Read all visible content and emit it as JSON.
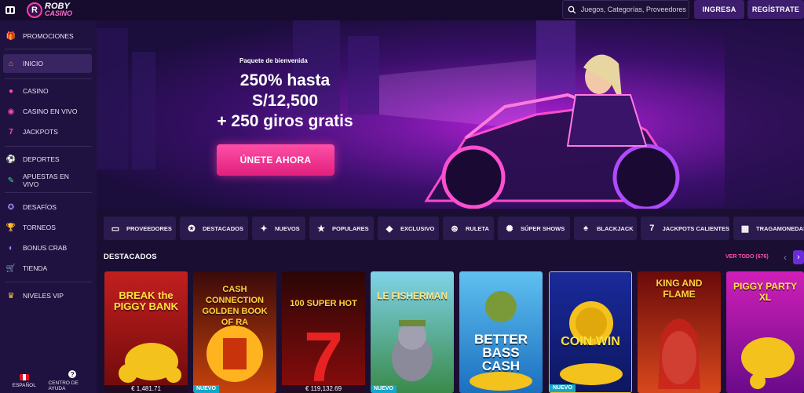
{
  "topbar": {
    "logo_line1": "ROBY",
    "logo_line2": "CASINO",
    "logo_mark": "R",
    "search_placeholder": "Juegos, Categorías, Proveedores",
    "login_label": "INGRESA",
    "register_label": "REGÍSTRATE"
  },
  "sidebar": {
    "items": [
      {
        "label": "PROMOCIONES",
        "icon": "gift-icon",
        "glyph": "🎁"
      },
      {
        "label": "INICIO",
        "icon": "home-icon",
        "glyph": "⌂"
      },
      {
        "label": "CASINO",
        "icon": "chip-icon",
        "glyph": "●"
      },
      {
        "label": "CASINO EN VIVO",
        "icon": "live-icon",
        "glyph": "◉"
      },
      {
        "label": "JACKPOTS",
        "icon": "seven-icon",
        "glyph": "7"
      },
      {
        "label": "DEPORTES",
        "icon": "ball-icon",
        "glyph": "⚽"
      },
      {
        "label": "APUESTAS EN VIVO",
        "icon": "ticket-icon",
        "glyph": "✎"
      },
      {
        "label": "DESAFÍOS",
        "icon": "medal-icon",
        "glyph": "✪"
      },
      {
        "label": "TORNEOS",
        "icon": "trophy-icon",
        "glyph": "🏆"
      },
      {
        "label": "BONUS CRAB",
        "icon": "crab-icon",
        "glyph": "◐"
      },
      {
        "label": "TIENDA",
        "icon": "cart-icon",
        "glyph": "🛒"
      },
      {
        "label": "NIVELES VIP",
        "icon": "crown-icon",
        "glyph": "♛"
      }
    ],
    "language_label": "ESPAÑOL",
    "help_label": "CENTRO DE AYUDA"
  },
  "hero": {
    "subtitle": "Paquete de bienvenida",
    "title_line1": "250% hasta",
    "title_line2": "S/12,500",
    "title_line3": "+ 250 giros gratis",
    "cta_label": "ÚNETE AHORA"
  },
  "chips": [
    {
      "label": "PROVEEDORES",
      "glyph": "▭"
    },
    {
      "label": "DESTACADOS",
      "glyph": "✪"
    },
    {
      "label": "NUEVOS",
      "glyph": "✦"
    },
    {
      "label": "POPULARES",
      "glyph": "★"
    },
    {
      "label": "EXCLUSIVO",
      "glyph": "◆"
    },
    {
      "label": "RULETA",
      "glyph": "⊛"
    },
    {
      "label": "SÚPER SHOWS",
      "glyph": "✺"
    },
    {
      "label": "BLACKJACK",
      "glyph": "♠"
    },
    {
      "label": "JACKPOTS CALIENTES",
      "glyph": "7"
    },
    {
      "label": "TRAGAMONEDAS",
      "glyph": "▦"
    }
  ],
  "section": {
    "title": "DESTACADOS",
    "see_all": "VER TODO (676)"
  },
  "games": [
    {
      "name": "BREAK the PIGGY BANK",
      "footer": "€ 1,481.71",
      "badge": ""
    },
    {
      "name": "CASH CONNECTION GOLDEN BOOK OF RA",
      "footer": "",
      "badge": "NUEVO"
    },
    {
      "name": "100 SUPER HOT",
      "footer": "€ 119,132.69",
      "badge": ""
    },
    {
      "name": "LE FISHERMAN",
      "footer": "",
      "badge": "NUEVO"
    },
    {
      "name": "BETTER BASS CASH",
      "footer": "",
      "badge": ""
    },
    {
      "name": "COIN WIN",
      "footer": "",
      "badge": "NUEVO"
    },
    {
      "name": "KING AND FLAME",
      "footer": "",
      "badge": ""
    },
    {
      "name": "PIGGY PARTY XL",
      "footer": "",
      "badge": ""
    }
  ]
}
